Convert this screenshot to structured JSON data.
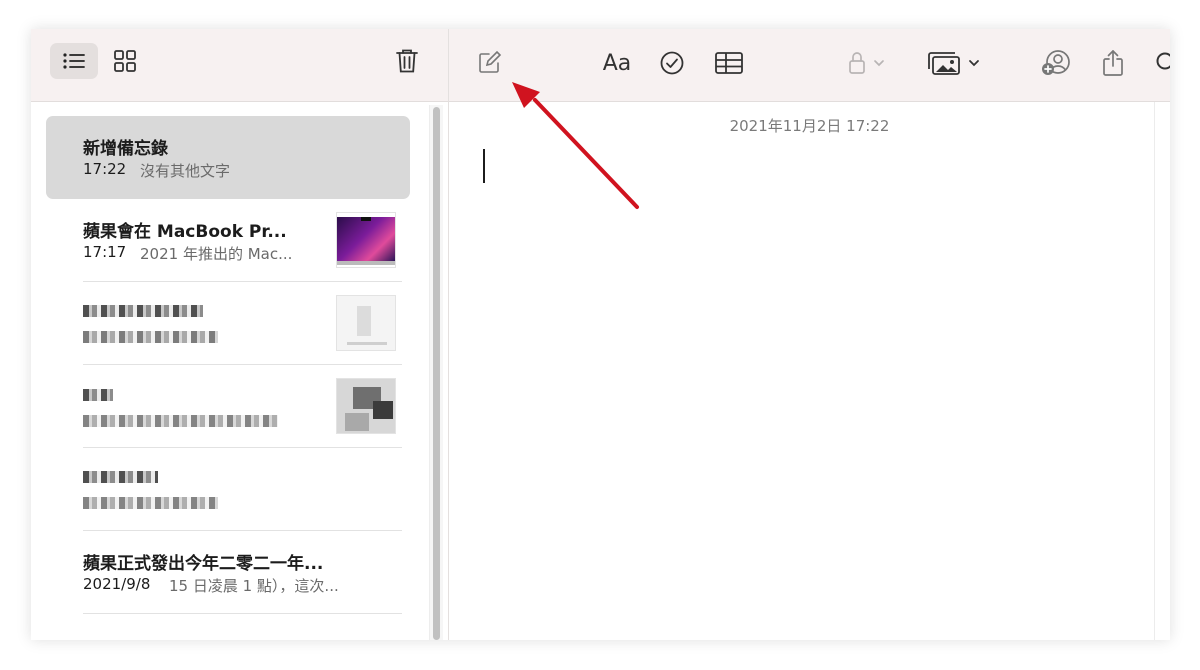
{
  "sidebar": {
    "toolbar": {
      "list_view_icon": "list-icon",
      "grid_view_icon": "grid-icon",
      "delete_icon": "trash-icon"
    },
    "notes": [
      {
        "title": "新增備忘錄",
        "time": "17:22",
        "preview": "沒有其他文字",
        "selected": true
      },
      {
        "title": "蘋果會在 MacBook Pr...",
        "time": "17:17",
        "preview": "2021 年推出的 Mac...",
        "thumbnail": "macbook-image"
      },
      {
        "blurred": true,
        "thumbnail": "blurred-image"
      },
      {
        "blurred": true,
        "thumbnail": "blurred-image"
      },
      {
        "blurred": true
      },
      {
        "title": "蘋果正式發出今年二零二一年...",
        "time": "2021/9/8",
        "preview": "15 日凌晨 1 點），這次..."
      },
      {
        "title": "…"
      }
    ]
  },
  "toolbar": {
    "compose_icon": "compose-icon",
    "format_label": "Aa",
    "checklist_icon": "checklist-icon",
    "table_icon": "table-icon",
    "lock_icon": "lock-icon",
    "media_icon": "photo-icon",
    "collaborate_icon": "collaborate-icon",
    "share_icon": "share-icon",
    "search_icon": "search-icon"
  },
  "editor": {
    "date": "2021年11月2日 17:22",
    "content": ""
  },
  "annotation": {
    "color": "#d0131f"
  }
}
